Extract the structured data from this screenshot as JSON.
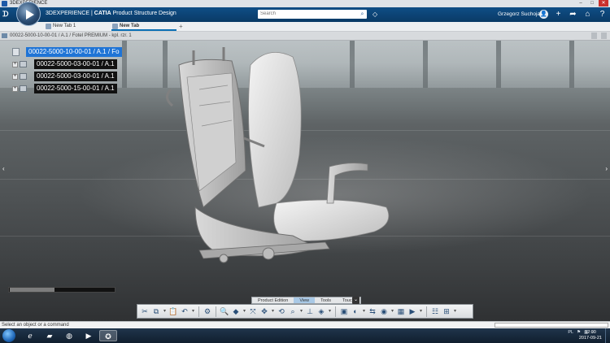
{
  "os_window": {
    "title": "3DEXPERIENCE",
    "controls": [
      "–",
      "□",
      "✕"
    ]
  },
  "header": {
    "brand": "3DEXPERIENCE",
    "separator": " | ",
    "product": "CATIA",
    "app_name": "Product Structure Design",
    "search_placeholder": "Search",
    "user_name": "Grzegorz Suchojad",
    "icons": [
      "user-icon",
      "add-icon",
      "share-icon",
      "home-icon",
      "help-icon"
    ]
  },
  "tabs": [
    {
      "label": "New Tab 1",
      "active": false
    },
    {
      "label": "New Tab",
      "active": true
    }
  ],
  "tab_add": "+",
  "breadcrumb": "00022-5000-10-00-01 / A.1 / Fotel PREMIUM - kpl. rzr. 1",
  "tree": [
    {
      "label": "00022-5000-10-00-01 / A.1 / Fo",
      "selected": true,
      "expander": ""
    },
    {
      "label": "00022-5000-03-00-01 / A.1",
      "selected": false,
      "expander": "+"
    },
    {
      "label": "00022-5000-03-00-01 / A.1",
      "selected": false,
      "expander": "+"
    },
    {
      "label": "00022-5000-15-00-01 / A.1",
      "selected": false,
      "expander": "+"
    }
  ],
  "progress": {
    "value": 0.42
  },
  "action_bar": {
    "tabs": [
      {
        "label": "Product Edition",
        "active": false
      },
      {
        "label": "View",
        "active": true
      },
      {
        "label": "Tools",
        "active": false
      },
      {
        "label": "Touch",
        "active": false
      }
    ],
    "collapse": "⌄",
    "buttons": [
      {
        "name": "cut-icon",
        "glyph": "✂"
      },
      {
        "name": "copy-icon",
        "glyph": "⧉"
      },
      {
        "name": "paste-icon",
        "glyph": "📋"
      },
      {
        "name": "undo-icon",
        "glyph": "↶"
      },
      {
        "name": "settings-icon",
        "glyph": "⚙"
      },
      {
        "name": "zoom-icon",
        "glyph": "🔍"
      },
      {
        "name": "cube-view-icon",
        "glyph": "◆"
      },
      {
        "name": "fit-all-icon",
        "glyph": "⤧"
      },
      {
        "name": "pan-icon",
        "glyph": "✥"
      },
      {
        "name": "rotate-icon",
        "glyph": "⟲"
      },
      {
        "name": "zoom-area-icon",
        "glyph": "⌕"
      },
      {
        "name": "normal-view-icon",
        "glyph": "⊥"
      },
      {
        "name": "iso-view-icon",
        "glyph": "◈"
      },
      {
        "name": "render-style-icon",
        "glyph": "▣"
      },
      {
        "name": "hide-show-icon",
        "glyph": "◐"
      },
      {
        "name": "swap-visible-icon",
        "glyph": "⇆"
      },
      {
        "name": "ambience-icon",
        "glyph": "◉"
      },
      {
        "name": "layout-icon",
        "glyph": "▦"
      },
      {
        "name": "play-icon",
        "glyph": "▶"
      },
      {
        "name": "tree-icon",
        "glyph": "☷"
      },
      {
        "name": "measure-icon",
        "glyph": "⊞"
      }
    ]
  },
  "status_bar": {
    "text": "Select an object or a command"
  },
  "taskbar": {
    "apps": [
      "ie-icon",
      "folder-icon",
      "firefox-icon",
      "media-icon",
      "3dexperience-icon"
    ],
    "tray_lang": "PL",
    "time": "12:00",
    "date": "2017-09-21"
  }
}
